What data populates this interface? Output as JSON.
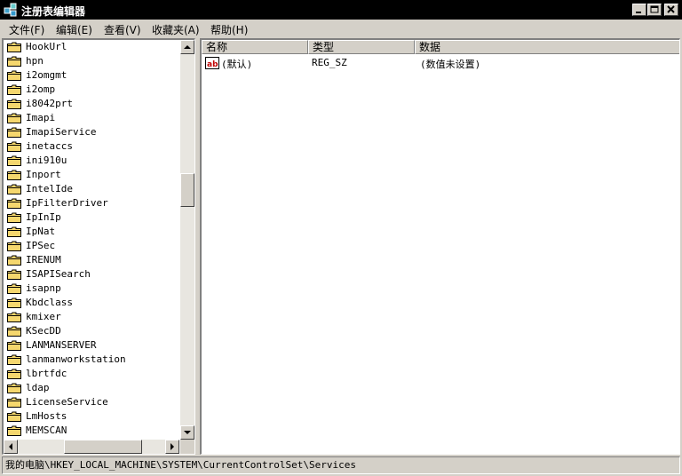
{
  "window": {
    "title": "注册表编辑器"
  },
  "menu": [
    "文件(F)",
    "编辑(E)",
    "查看(V)",
    "收藏夹(A)",
    "帮助(H)"
  ],
  "tree": {
    "items": [
      "HookUrl",
      "hpn",
      "i2omgmt",
      "i2omp",
      "i8042prt",
      "Imapi",
      "ImapiService",
      "inetaccs",
      "ini910u",
      "Inport",
      "IntelIde",
      "IpFilterDriver",
      "IpInIp",
      "IpNat",
      "IPSec",
      "IRENUM",
      "ISAPISearch",
      "isapnp",
      "Kbdclass",
      "kmixer",
      "KSecDD",
      "LANMANSERVER",
      "lanmanworkstation",
      "lbrtfdc",
      "ldap",
      "LicenseService",
      "LmHosts",
      "MEMSCAN"
    ]
  },
  "list": {
    "columns": [
      "名称",
      "类型",
      "数据"
    ],
    "rows": [
      {
        "name": "(默认)",
        "type": "REG_SZ",
        "data": "(数值未设置)",
        "icon": "string-value-icon"
      }
    ]
  },
  "status": {
    "path": "我的电脑\\HKEY_LOCAL_MACHINE\\SYSTEM\\CurrentControlSet\\Services"
  },
  "colors": {
    "titlebar": "#000000",
    "window_bg": "#d4d0c8",
    "folder": "#f5d76e"
  }
}
